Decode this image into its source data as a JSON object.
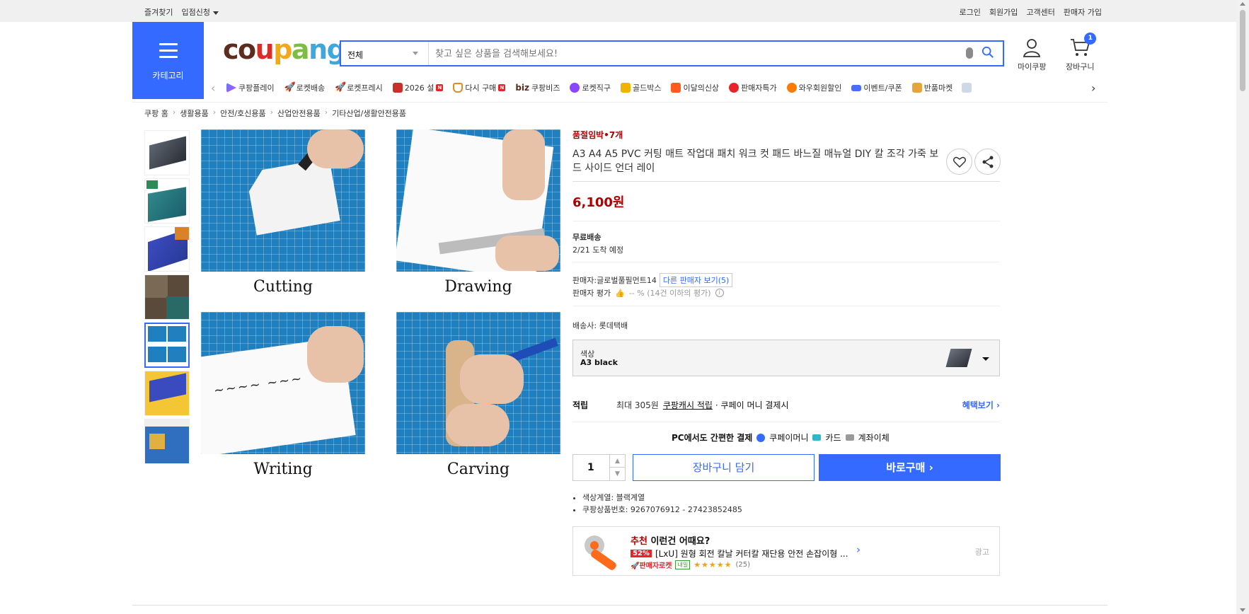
{
  "topbar": {
    "left": [
      "즐겨찾기",
      "입점신청"
    ],
    "right": [
      "로그인",
      "회원가입",
      "고객센터",
      "판매자 가입"
    ]
  },
  "header": {
    "category_label": "카테고리",
    "logo": "coupang",
    "search": {
      "category": "전체",
      "placeholder": "찾고 싶은 상품을 검색해보세요!"
    },
    "my_label": "마이쿠팡",
    "cart_label": "장바구니",
    "cart_count": "1"
  },
  "subnav": [
    "쿠팡플레이",
    "로켓배송",
    "로켓프레시",
    "2026 설",
    "다시 구매",
    "쿠팡비즈",
    "로켓직구",
    "골드박스",
    "이달의신상",
    "판매자특가",
    "와우회원할인",
    "이벤트/쿠폰",
    "반품마켓"
  ],
  "breadcrumb": [
    "쿠팡 홈",
    "생활용품",
    "안전/호신용품",
    "산업안전용품",
    "기타산업/생활안전용품"
  ],
  "gallery": {
    "captions": [
      "Cutting",
      "Drawing",
      "Writing",
      "Carving"
    ]
  },
  "product": {
    "stock": "품절임박•7개",
    "title": "A3 A4 A5 PVC 커팅 매트 작업대 패치 워크 컷 패드 바느질 매뉴얼 DIY 칼 조각 가죽 보드 사이드 언더 레이",
    "price": "6,100원",
    "shipping_label": "무료배송",
    "arrival": "2/21 도착 예정",
    "seller_label": "판매자:",
    "seller_name": "글로벌풀필먼트14",
    "other_sellers": "다른 판매자 보기(5)",
    "seller_rating_label": "판매자 평가",
    "seller_rating_value": "-- % (14건 이하의 평가)",
    "carrier_label": "배송사:",
    "carrier": "롯데택배",
    "option_label": "색상",
    "option_value": "A3 black",
    "reward_label": "적립",
    "reward_text_1": "최대 305원",
    "reward_text_2": "쿠팡캐시 적립",
    "reward_text_3": "· 쿠페이 머니 결제시",
    "benefit_link": "혜택보기",
    "pay_title": "PC에서도 간편한 결제",
    "pay_1": "쿠페이머니",
    "pay_2": "카드",
    "pay_3": "계좌이체",
    "qty": "1",
    "cart_button": "장바구니 담기",
    "buy_button": "바로구매",
    "bullets": [
      "색상계열: 블랙계열",
      "쿠팡상품번호: 9267076912 - 27423852485"
    ]
  },
  "recommend": {
    "title_red": "추천",
    "title": "이런건 어때요?",
    "discount": "52%",
    "name": "[LxU] 원형 회전 칼날 커터칼 재단용 안전 손잡이형 ...",
    "rocket": "판매자로켓",
    "tomorrow": "내일",
    "stars": "★★★★★",
    "reviews": "(25)",
    "ad": "광고"
  }
}
